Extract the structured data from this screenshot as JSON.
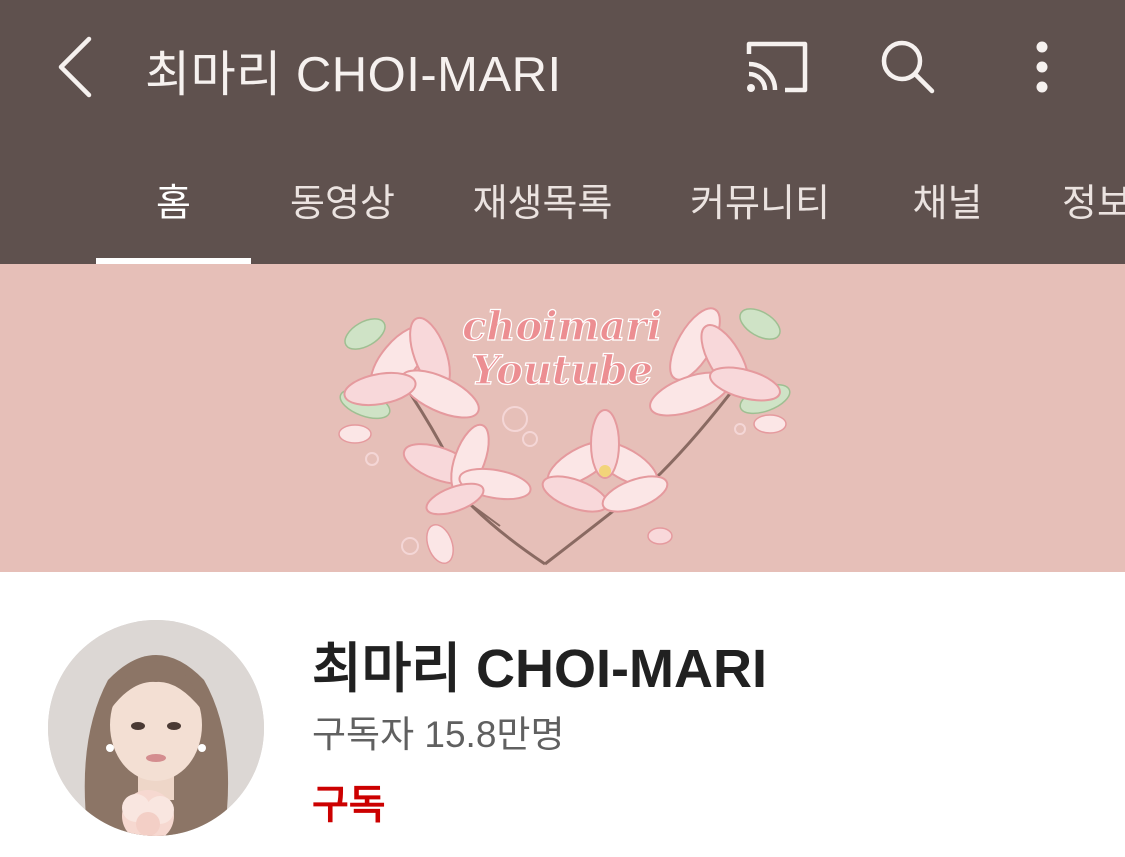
{
  "header": {
    "title": "최마리 CHOI-MARI",
    "back_icon": "chevron-left-icon",
    "actions": [
      {
        "name": "cast",
        "icon": "cast-icon"
      },
      {
        "name": "search",
        "icon": "search-icon"
      },
      {
        "name": "more",
        "icon": "more-vertical-icon"
      }
    ]
  },
  "tabs": [
    {
      "label": "홈",
      "active": true
    },
    {
      "label": "동영상",
      "active": false
    },
    {
      "label": "재생목록",
      "active": false
    },
    {
      "label": "커뮤니티",
      "active": false
    },
    {
      "label": "채널",
      "active": false
    },
    {
      "label": "정보",
      "active": false
    }
  ],
  "banner": {
    "line1": "choimari",
    "line2": "Youtube",
    "background": "#e6bfb8"
  },
  "channel": {
    "name": "최마리 CHOI-MARI",
    "subscribers": "구독자 15.8만명",
    "subscribe_label": "구독"
  },
  "colors": {
    "app_bar": "#5f514e",
    "subscribe": "#cc0000",
    "banner_text": "#ec8e92"
  }
}
